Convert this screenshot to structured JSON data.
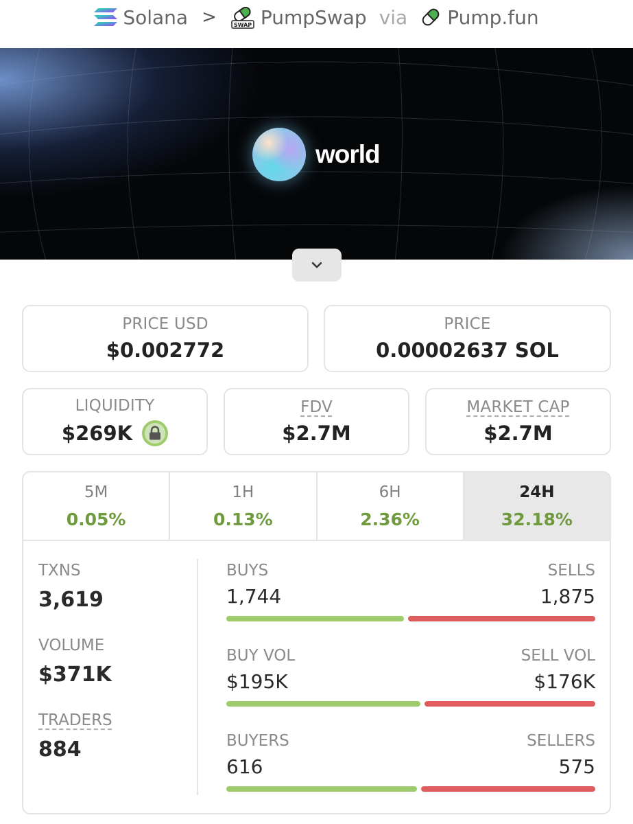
{
  "breadcrumb": {
    "chain": "Solana",
    "dex": "PumpSwap",
    "dex_badge": "SWAP",
    "via": "via",
    "launchpad": "Pump.fun"
  },
  "banner": {
    "logo_text": "world"
  },
  "cards": {
    "price_usd": {
      "label": "PRICE USD",
      "value": "$0.002772"
    },
    "price": {
      "label": "PRICE",
      "value": "0.00002637 SOL"
    },
    "liquidity": {
      "label": "LIQUIDITY",
      "value": "$269K"
    },
    "fdv": {
      "label": "FDV",
      "value": "$2.7M"
    },
    "market_cap": {
      "label": "MARKET CAP",
      "value": "$2.7M"
    }
  },
  "tabs": [
    {
      "label": "5M",
      "value": "0.05%"
    },
    {
      "label": "1H",
      "value": "0.13%"
    },
    {
      "label": "6H",
      "value": "2.36%"
    },
    {
      "label": "24H",
      "value": "32.18%"
    }
  ],
  "active_tab": "24H",
  "metrics": {
    "txns": {
      "label": "TXNS",
      "value": "3,619"
    },
    "volume": {
      "label": "VOLUME",
      "value": "$371K"
    },
    "traders": {
      "label": "TRADERS",
      "value": "884"
    }
  },
  "pairs": [
    {
      "left_label": "BUYS",
      "left_value": "1,744",
      "right_label": "SELLS",
      "right_value": "1,875",
      "buy_fraction": 0.482
    },
    {
      "left_label": "BUY VOL",
      "left_value": "$195K",
      "right_label": "SELL VOL",
      "right_value": "$176K",
      "buy_fraction": 0.526
    },
    {
      "left_label": "BUYERS",
      "left_value": "616",
      "right_label": "SELLERS",
      "right_value": "575",
      "buy_fraction": 0.517
    }
  ],
  "colors": {
    "positive": "#6f9a3e",
    "buy_bar": "#9ecb6c",
    "sell_bar": "#e05d5d"
  }
}
